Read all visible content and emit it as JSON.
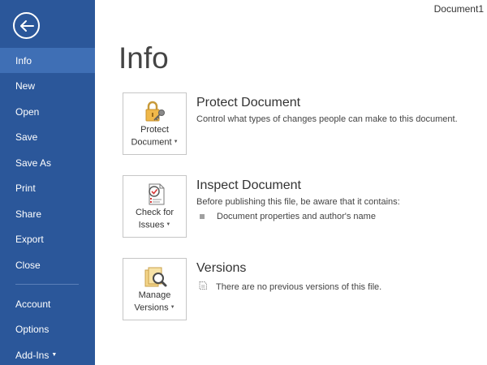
{
  "window": {
    "doc_title": "Document1"
  },
  "sidebar": {
    "back_icon": "back-arrow-icon",
    "items": [
      {
        "label": "Info",
        "active": true
      },
      {
        "label": "New"
      },
      {
        "label": "Open"
      },
      {
        "label": "Save"
      },
      {
        "label": "Save As"
      },
      {
        "label": "Print"
      },
      {
        "label": "Share"
      },
      {
        "label": "Export"
      },
      {
        "label": "Close"
      },
      {
        "label": "Account"
      },
      {
        "label": "Options"
      },
      {
        "label": "Add-Ins"
      }
    ],
    "colors": {
      "background": "#2b579a",
      "active": "#3f6fb5"
    }
  },
  "main": {
    "title": "Info",
    "sections": [
      {
        "button": {
          "line1": "Protect",
          "line2": "Document",
          "icon": "lock-key-icon"
        },
        "heading": "Protect Document",
        "description": "Control what types of changes people can make to this document."
      },
      {
        "button": {
          "line1": "Check for",
          "line2": "Issues",
          "icon": "inspect-document-icon"
        },
        "heading": "Inspect Document",
        "description": "Before publishing this file, be aware that it contains:",
        "bullets": [
          "Document properties and author's name"
        ]
      },
      {
        "button": {
          "line1": "Manage",
          "line2": "Versions",
          "icon": "magnifier-folder-icon"
        },
        "heading": "Versions",
        "note": "There are no previous versions of this file.",
        "note_icon": "versions-doc-icon"
      }
    ]
  }
}
